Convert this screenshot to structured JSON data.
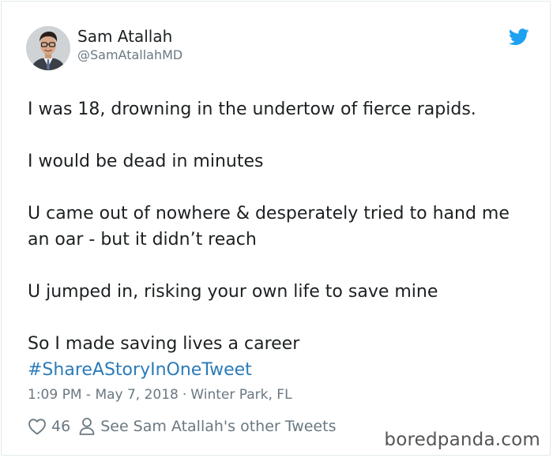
{
  "author": {
    "name": "Sam Atallah",
    "handle": "@SamAtallahMD"
  },
  "tweet": {
    "paragraphs": [
      "I was 18, drowning in the undertow of fierce rapids.",
      "I would be dead in minutes",
      "U came out of nowhere  & desperately tried to hand me an oar - but it didn’t reach",
      "U jumped in, risking your own life to save mine",
      "So I made saving lives a career"
    ],
    "hashtag": "#ShareAStoryInOneTweet"
  },
  "meta": {
    "time": "1:09 PM - May 7, 2018",
    "separator": "·",
    "location": "Winter Park, FL"
  },
  "actions": {
    "likes": "46",
    "other_tweets_label": "See Sam Atallah's other Tweets"
  },
  "watermark": "boredpanda.com",
  "icons": {
    "brand": "twitter-bird-icon",
    "like": "heart-icon",
    "profile": "person-icon"
  },
  "colors": {
    "twitter_blue": "#1da1f2",
    "link": "#2b7bb9",
    "secondary_text": "#697882"
  }
}
